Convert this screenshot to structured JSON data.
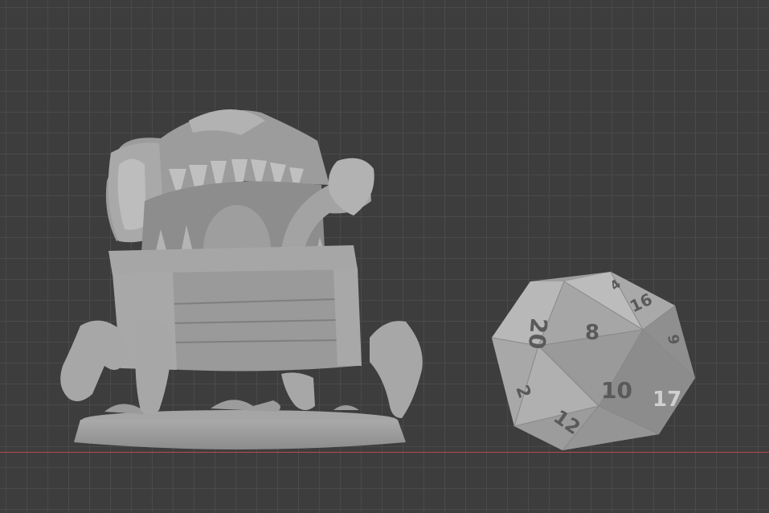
{
  "viewport": {
    "background_color": "#3d3d3d",
    "grid_color": "#4a4a4a",
    "x_axis_color": "#b84a4a"
  },
  "objects": [
    {
      "name": "mimic-chest-miniature",
      "icon": "mimic-chest-mesh"
    },
    {
      "name": "d20-die",
      "icon": "d20-mesh"
    }
  ],
  "d20_faces": {
    "face_8": "8",
    "face_20": "20",
    "face_10": "10",
    "face_2": "2",
    "face_12": "12",
    "face_16": "16",
    "face_4": "4",
    "face_9": "9",
    "face_17": "17"
  }
}
